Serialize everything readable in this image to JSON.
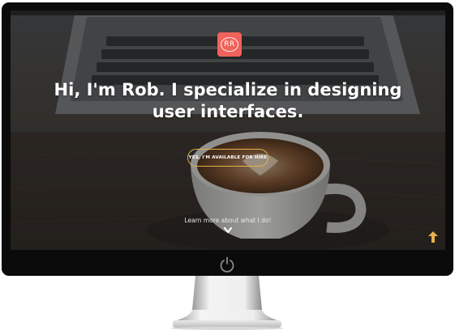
{
  "logo": {
    "initials": "RR",
    "color": "#f0625a"
  },
  "hero": {
    "headline_line1": "Hi, I'm Rob. I specialize in designing",
    "headline_line2": "user interfaces.",
    "cta_label": "YES, I'M AVAILABLE FOR HIRE",
    "cta_border_color": "#e6b24a",
    "learn_more": "Learn more about what I do!"
  },
  "icons": {
    "scroll_down": "chevron-down-icon",
    "back_to_top": "arrow-up-icon",
    "power": "power-icon",
    "up_arrow_color": "#e6b24a"
  }
}
